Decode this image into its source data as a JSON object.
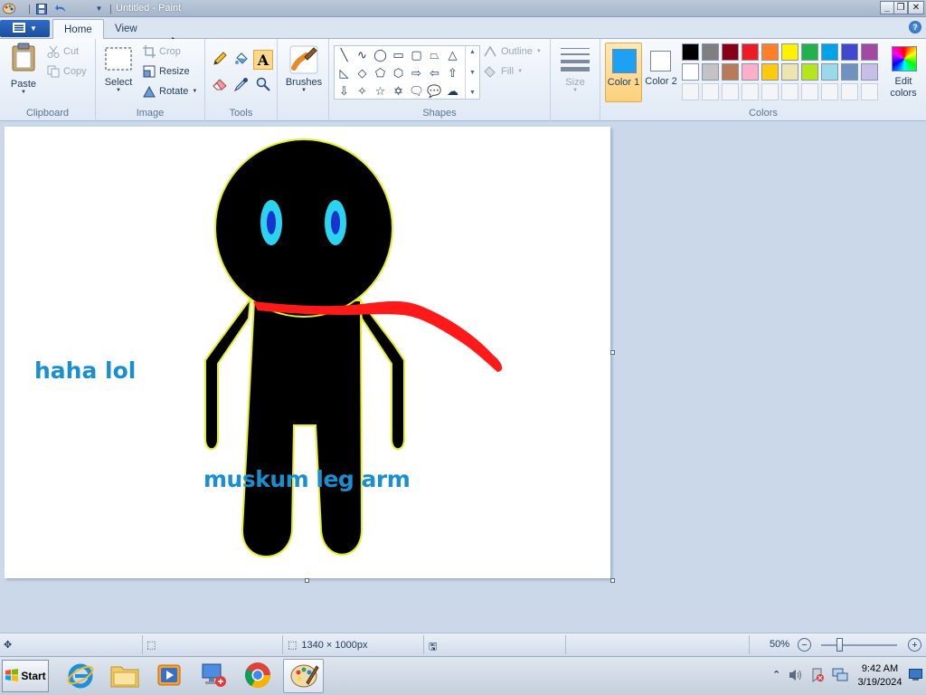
{
  "window": {
    "title": "Untitled - Paint"
  },
  "tabs": [
    {
      "label": "Home",
      "active": true
    },
    {
      "label": "View",
      "active": false
    }
  ],
  "ribbon": {
    "clipboard": {
      "paste_label": "Paste",
      "cut_label": "Cut",
      "copy_label": "Copy",
      "group_label": "Clipboard"
    },
    "image": {
      "select_label": "Select",
      "crop_label": "Crop",
      "resize_label": "Resize",
      "rotate_label": "Rotate",
      "group_label": "Image"
    },
    "tools": {
      "group_label": "Tools"
    },
    "brushes_label": "Brushes",
    "shapes": {
      "outline_label": "Outline",
      "fill_label": "Fill",
      "group_label": "Shapes"
    },
    "size_label": "Size",
    "color1_label": "Color 1",
    "color2_label": "Color 2",
    "edit_colors_label": "Edit colors",
    "colors_group_label": "Colors",
    "color1_value": "#1da1f2",
    "color2_value": "#ffffff",
    "palette_row1": [
      "#000000",
      "#7f7f7f",
      "#880015",
      "#ed1c24",
      "#ff7f27",
      "#fff200",
      "#22b14c",
      "#00a2e8",
      "#3f48cc",
      "#a349a4"
    ],
    "palette_row2": [
      "#ffffff",
      "#c3c3c3",
      "#b97a57",
      "#ffaec9",
      "#ffc90e",
      "#efe4b0",
      "#b5e61d",
      "#99d9ea",
      "#7092be",
      "#c8bfe7"
    ]
  },
  "canvas": {
    "text1": "haha lol",
    "text2": "muskum leg arm",
    "text_color": "#1a8fd0"
  },
  "statusbar": {
    "dimensions": "1340 × 1000px",
    "zoom": "50%"
  },
  "taskbar": {
    "start_label": "Start",
    "time": "9:42 AM",
    "date": "3/19/2024"
  }
}
